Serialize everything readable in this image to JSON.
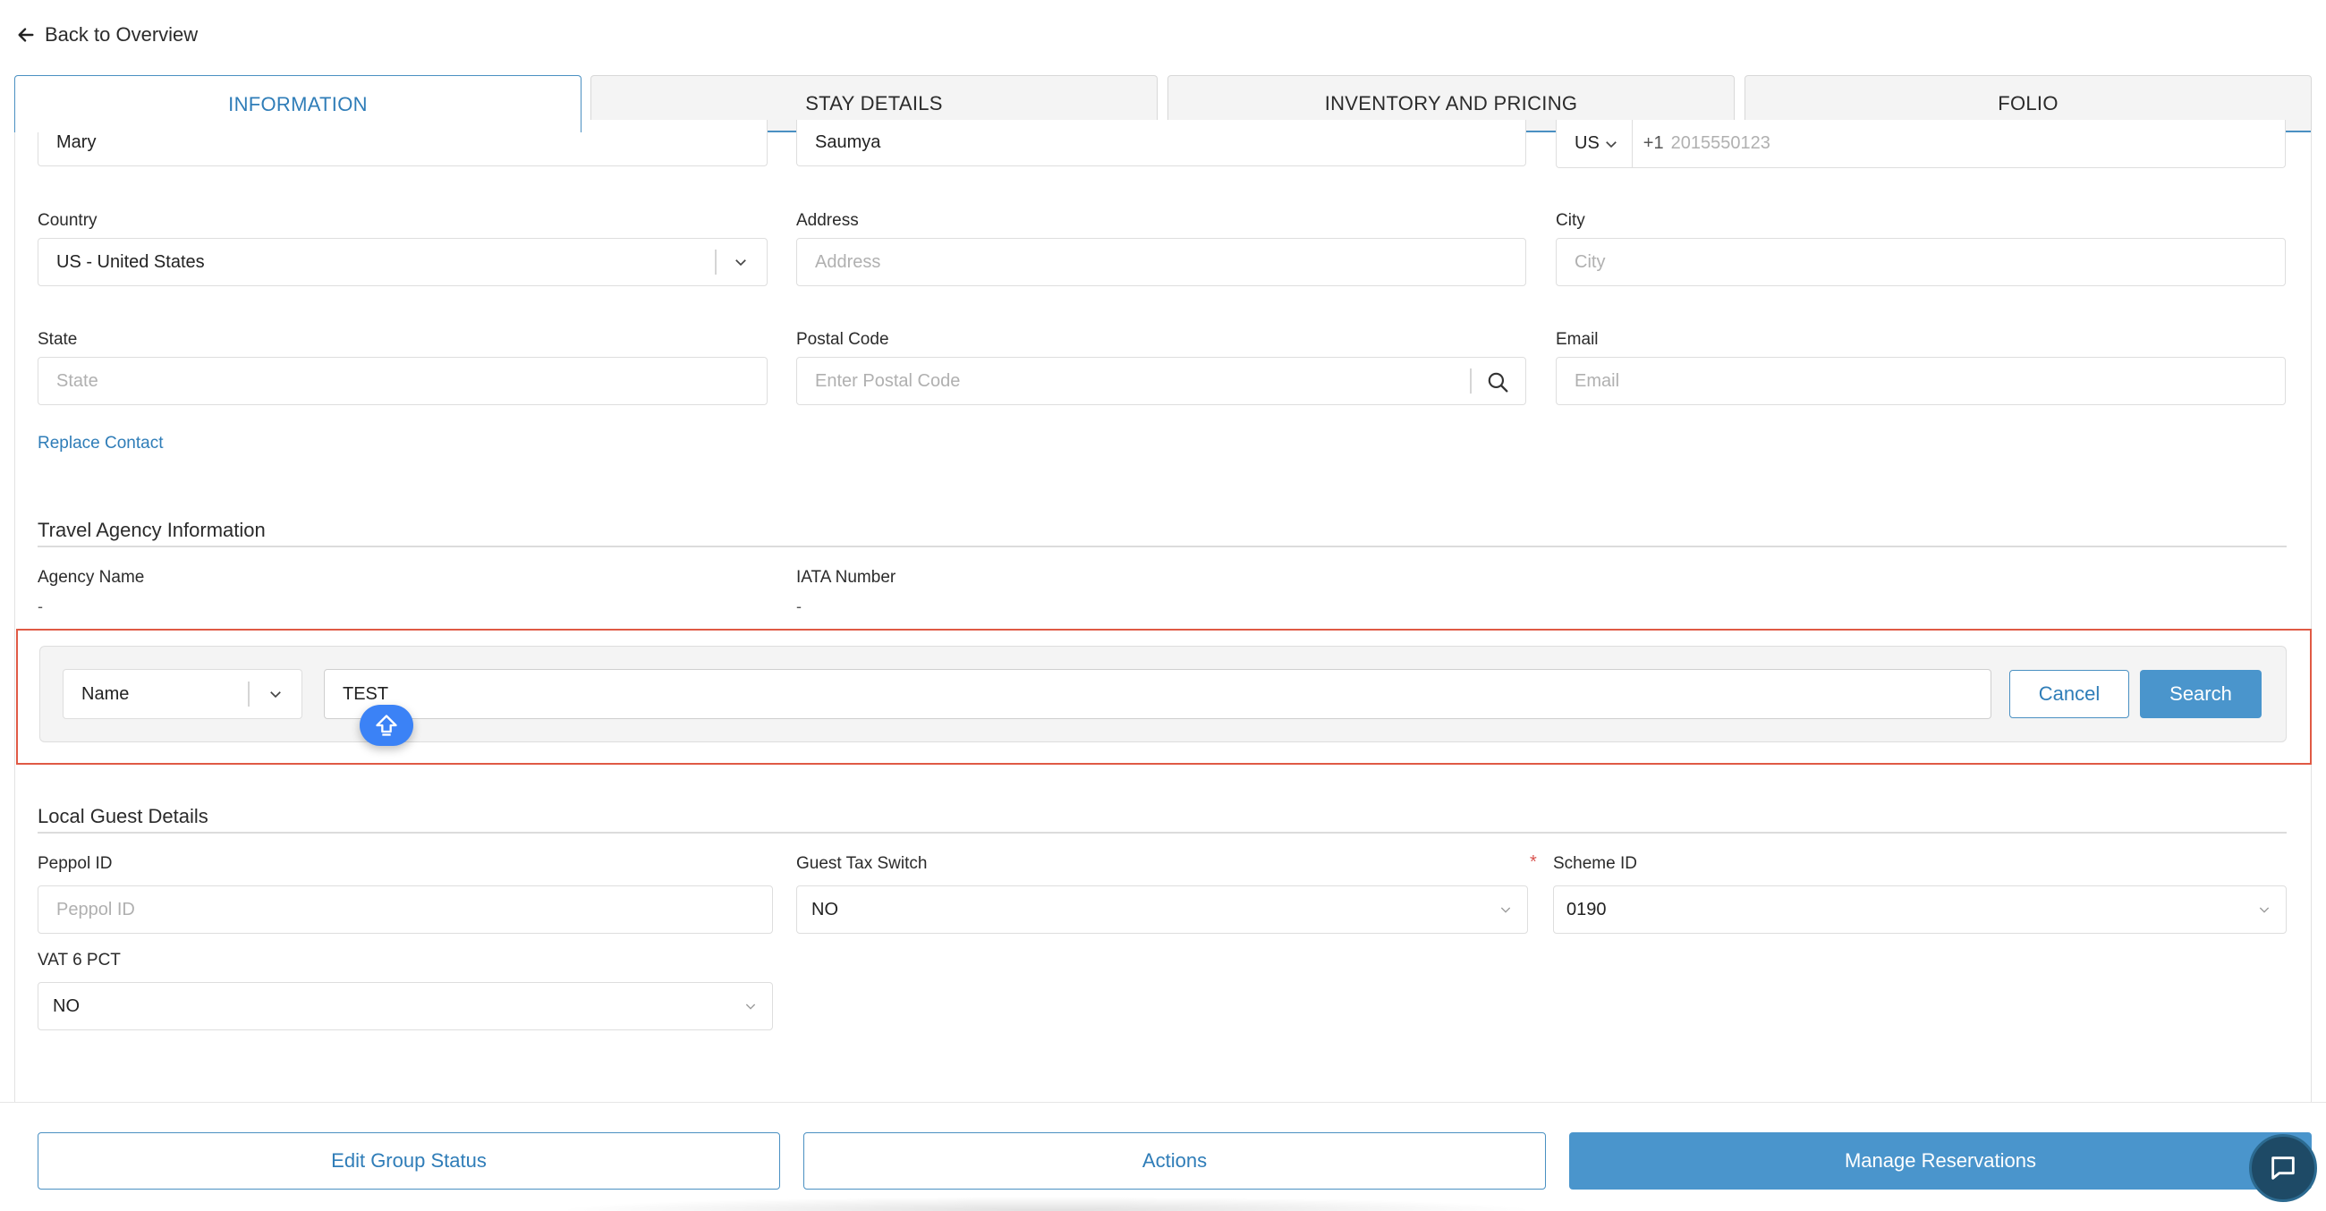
{
  "header": {
    "back_label": "Back to Overview"
  },
  "tabs": [
    {
      "label": "INFORMATION",
      "active": true
    },
    {
      "label": "STAY DETAILS",
      "active": false
    },
    {
      "label": "INVENTORY AND PRICING",
      "active": false
    },
    {
      "label": "FOLIO",
      "active": false
    }
  ],
  "contact": {
    "first_name_value": "Mary",
    "last_name_value": "Saumya",
    "phone": {
      "country_code": "US",
      "dial_prefix": "+1",
      "placeholder": "2015550123"
    },
    "country": {
      "label": "Country",
      "value": "US - United States"
    },
    "address": {
      "label": "Address",
      "placeholder": "Address"
    },
    "city": {
      "label": "City",
      "placeholder": "City"
    },
    "state": {
      "label": "State",
      "placeholder": "State"
    },
    "postal_code": {
      "label": "Postal Code",
      "placeholder": "Enter Postal Code"
    },
    "email": {
      "label": "Email",
      "placeholder": "Email"
    },
    "replace_contact_label": "Replace Contact"
  },
  "travel_agency": {
    "title": "Travel Agency Information",
    "agency_name_label": "Agency Name",
    "agency_name_value": "-",
    "iata_label": "IATA Number",
    "iata_value": "-"
  },
  "search_bar": {
    "field_select_value": "Name",
    "query_value": "TEST",
    "cancel_label": "Cancel",
    "search_label": "Search"
  },
  "local_guest": {
    "title": "Local Guest Details",
    "peppol_label": "Peppol ID",
    "peppol_placeholder": "Peppol ID",
    "tax_switch_label": "Guest Tax Switch",
    "tax_switch_value": "NO",
    "scheme_label": "Scheme ID",
    "scheme_required_mark": "*",
    "scheme_value": "0190",
    "vat_label": "VAT 6 PCT",
    "vat_value": "NO"
  },
  "footer": {
    "edit_group_status_label": "Edit Group Status",
    "actions_label": "Actions",
    "manage_reservations_label": "Manage Reservations"
  },
  "colors": {
    "accent": "#4a90c2",
    "primary_button": "#4a95cc",
    "highlight_border": "#e05a45",
    "chat_button": "#1e4a66",
    "shift_badge": "#3b82f6"
  },
  "icons": [
    "back-arrow-icon",
    "chevron-down-icon",
    "search-icon",
    "shift-arrow-icon",
    "chat-icon"
  ]
}
